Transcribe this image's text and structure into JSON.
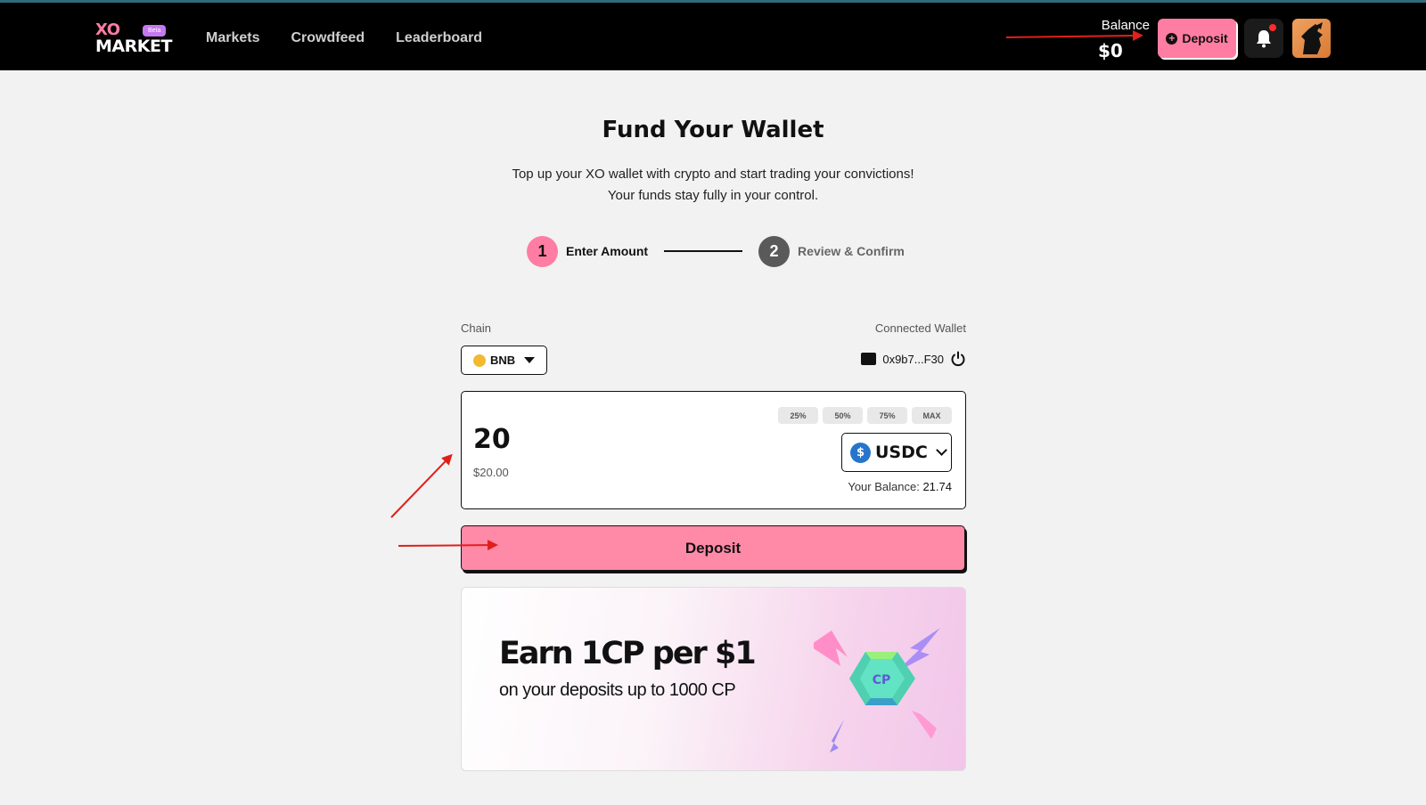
{
  "header": {
    "logo_top": "XO",
    "logo_bottom": "MARKET",
    "beta_badge": "Beta",
    "nav": [
      "Markets",
      "Crowdfeed",
      "Leaderboard"
    ],
    "balance_label": "Balance",
    "balance_value": "$0",
    "deposit_label": "Deposit"
  },
  "page": {
    "title": "Fund Your Wallet",
    "subtitle_line1": "Top up your XO wallet with crypto and start trading your convictions!",
    "subtitle_line2": "Your funds stay fully in your control."
  },
  "stepper": {
    "steps": [
      {
        "number": "1",
        "label": "Enter Amount"
      },
      {
        "number": "2",
        "label": "Review & Confirm"
      }
    ]
  },
  "form": {
    "chain_label": "Chain",
    "chain_value": "BNB",
    "wallet_label": "Connected Wallet",
    "wallet_address": "0x9b7...F30",
    "amount": "20",
    "amount_usd": "$20.00",
    "percent_options": [
      "25%",
      "50%",
      "75%",
      "MAX"
    ],
    "token": "USDC",
    "balance_prefix": "Your Balance:",
    "balance_value": "21.74",
    "submit_label": "Deposit"
  },
  "promo": {
    "title": "Earn 1CP per $1",
    "subtitle": "on your deposits up to 1000 CP",
    "gem_label": "CP"
  },
  "colors": {
    "accent_pink": "#ff7da2",
    "header_bg": "#000000",
    "annotation_red": "#e0201c"
  }
}
